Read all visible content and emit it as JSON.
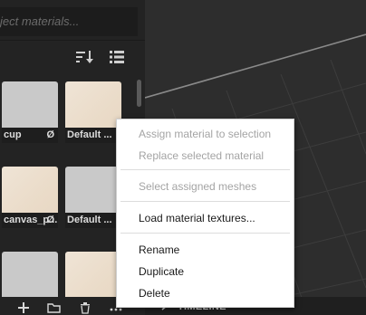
{
  "materials_panel": {
    "search": {
      "placeholder": "ject materials..."
    },
    "toolbar": {
      "sort_icon": "sort-descending-icon",
      "view_icon": "list-view-icon"
    },
    "thumbnails": [
      {
        "label": "cup",
        "badge": "Ø",
        "style": "grey"
      },
      {
        "label": "Default ...",
        "badge": "",
        "style": "paper"
      },
      {
        "label": "canvas_p...",
        "badge": "Ø",
        "style": "paper"
      },
      {
        "label": "Default ...",
        "badge": "",
        "style": "grey"
      },
      {
        "label": "",
        "badge": "",
        "style": "grey"
      },
      {
        "label": "",
        "badge": "",
        "style": "paper"
      }
    ],
    "bottom_icons": [
      "add-icon",
      "folder-icon",
      "trash-icon",
      "more-icon"
    ]
  },
  "viewport": {
    "timeline_label": "TIMELINE"
  },
  "context_menu": {
    "items": [
      {
        "label": "Assign material to selection",
        "enabled": false
      },
      {
        "label": "Replace selected material",
        "enabled": false
      },
      {
        "label": "Select assigned meshes",
        "enabled": false
      },
      {
        "label": "Load material textures...",
        "enabled": true
      },
      {
        "label": "Rename",
        "enabled": true
      },
      {
        "label": "Duplicate",
        "enabled": true
      },
      {
        "label": "Delete",
        "enabled": true
      }
    ]
  },
  "colors": {
    "panel_bg": "#232323",
    "viewport_bg": "#2d2d2d",
    "menu_bg": "#ffffff",
    "disabled_text": "#a4a4a4"
  }
}
